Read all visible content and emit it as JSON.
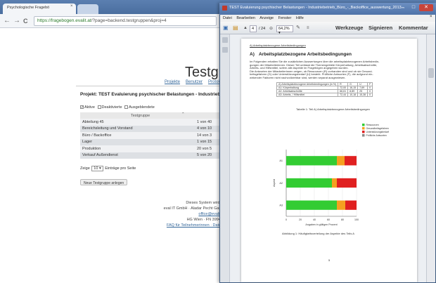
{
  "browser": {
    "tab_title": "Psychologische Fragebö",
    "tab_close": "×",
    "url_scheme": "https://",
    "url_host": "fragebogen.evalit.at",
    "url_path": "/?page=backend.testgruppen&proj=4",
    "nav_back": "←",
    "nav_forward": "→",
    "nav_reload": "C"
  },
  "page": {
    "heading": "Testgr",
    "nav": [
      "Projekte",
      "Benutzer",
      "Protokol"
    ],
    "project_title": "Projekt: TEST Evaluierung psychischer Belastungen - Industriebetrieb",
    "filters": [
      {
        "label": "Aktive",
        "checked": true
      },
      {
        "label": "Deaktivierte",
        "checked": false
      },
      {
        "label": "Ausgeblendete",
        "checked": false
      }
    ],
    "table_header": "Testgruppe",
    "rows": [
      {
        "name": "Abteilung 45",
        "value": "1 von 40"
      },
      {
        "name": "Bereichsleitung und Vorstand",
        "value": "4 von 10"
      },
      {
        "name": "Büro / Backoffice",
        "value": "14 von 3"
      },
      {
        "name": "Lager",
        "value": "1 von 15"
      },
      {
        "name": "Produktion",
        "value": "20 von 5"
      },
      {
        "name": "Verkauf Außendienst",
        "value": "5 von 20"
      }
    ],
    "show_prefix": "Zeige",
    "show_count": "10",
    "show_suffix": "Einträge pro Seite",
    "new_button": "Neue Testgruppe anlegen",
    "footer": [
      "Dieses System wird zu",
      "eval IT GmbH · Aladar Pecht Gasse",
      "office@evalit.at",
      "HG Wien · FN 399489",
      "FAQ für Teilnehmerinnen · Datens"
    ]
  },
  "pdf": {
    "window_title": "TEST Evaluierung psychischer Belastungen - Industriebetrieb_Büro_-_Backoffice_auswertung_2013...",
    "menu": [
      "Datei",
      "Bearbeiten",
      "Anzeige",
      "Fenster",
      "Hilfe"
    ],
    "page_current": "4",
    "page_total": "/ 24",
    "zoom": "64,2%",
    "tools": [
      "Werkzeuge",
      "Signieren",
      "Kommentar"
    ],
    "running_head": "A) Arbeitsplatzbezogene Arbeitsbedingungen",
    "heading_num": "A)",
    "heading": "Arbeitsplatzbezogene Arbeitsbedingungen",
    "intro": [
      "Im Folgenden erhalten Sie die zusätzlichen Auswertungen über die arbeitsplatzbezogenen Arbeitsbedin-",
      "gungen der Mitarbeiterinnen. Dieser Teil umfasst die Themengebiete Körperhaltung, Arbeitsabschnitte,",
      "Arbeits- und Hilfsmittel, sofern alle Aspekte im Fragebögen angegeben wurden.",
      "Die Antworten der Mitarbeiterinnen zeigen, ob Ressourcen (R) vorhanden sind und ob sie Gesund-",
      "heitsgefahren (G) oder Unterstützungsbedarf (U) besteht. Prüfliche Antworten (F), die aufgrund ein-",
      "wirkender Faktoren nicht nachvollziehbar sind, werden separat ausgewiesen."
    ],
    "table_head": [
      "A) Arbeitsplatzbezogene Arbeitsbedingungen (in %)",
      "R",
      "G",
      "U",
      "F"
    ],
    "table_rows": [
      [
        "A1: Körperhaltung",
        "72,00",
        "16,15",
        "7,69",
        "0"
      ],
      [
        "A2: Arbeitsabschnitte",
        "66,61",
        "8,89",
        "25",
        "0"
      ],
      [
        "A3: Arbeits- / Hilfsmittel",
        "72,44",
        "10,18",
        "15,38",
        "0"
      ]
    ],
    "table_caption": "Tabelle 1: Teil A) Arbeitsplatzbezogene Arbeitsbedingungen",
    "figure_caption": "Abbildung 1: Häufigkeitsverteilung der Aspekte des Teils A",
    "page_number": "5"
  },
  "chart_data": {
    "type": "bar",
    "orientation": "horizontal",
    "stacked": true,
    "categories": [
      "A1",
      "A2",
      "A3"
    ],
    "series": [
      {
        "name": "Ressourcen",
        "color": "#33cc33",
        "values": [
          72,
          65,
          72
        ]
      },
      {
        "name": "Gesundheitsgefahren",
        "color": "#f5a020",
        "values": [
          11,
          7,
          12
        ]
      },
      {
        "name": "Unterstützungsbedarf",
        "color": "#e02020",
        "values": [
          17,
          28,
          16
        ]
      },
      {
        "name": "Prüfliche Antworten",
        "color": "#888888",
        "values": [
          0,
          0,
          0
        ]
      }
    ],
    "xlabel": "Angaben in gültigen Prozent",
    "ylabel": "Aspekt",
    "xlim": [
      0,
      100
    ],
    "xticks": [
      "0",
      "20",
      "40",
      "60",
      "80",
      "100"
    ],
    "legend": "top-right"
  }
}
